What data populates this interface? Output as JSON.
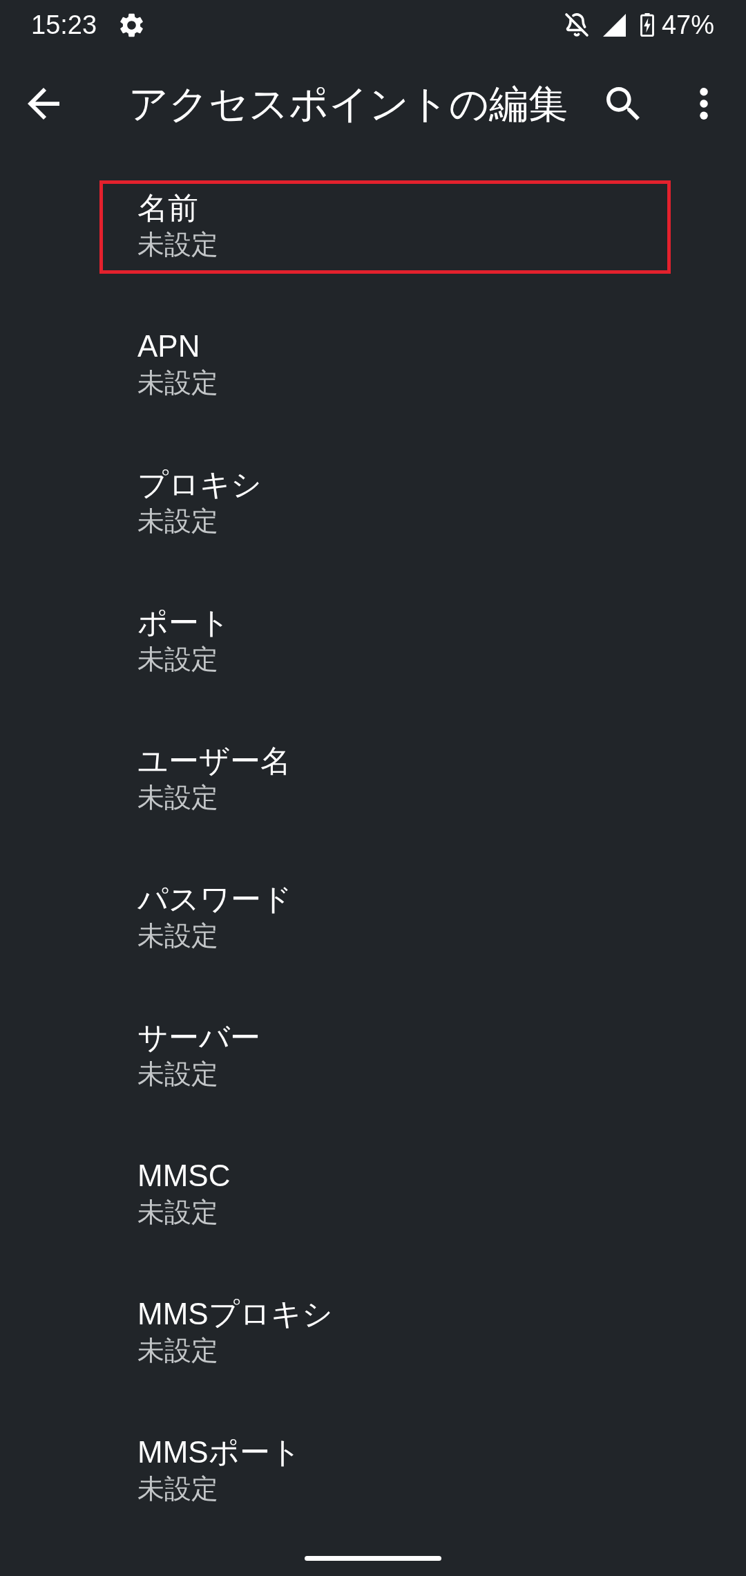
{
  "status_bar": {
    "time": "15:23",
    "battery": "47%"
  },
  "app_bar": {
    "title": "アクセスポイントの編集"
  },
  "items": [
    {
      "title": "名前",
      "summary": "未設定",
      "highlighted": true
    },
    {
      "title": "APN",
      "summary": "未設定",
      "highlighted": false
    },
    {
      "title": "プロキシ",
      "summary": "未設定",
      "highlighted": false
    },
    {
      "title": "ポート",
      "summary": "未設定",
      "highlighted": false
    },
    {
      "title": "ユーザー名",
      "summary": "未設定",
      "highlighted": false
    },
    {
      "title": "パスワード",
      "summary": "未設定",
      "highlighted": false
    },
    {
      "title": "サーバー",
      "summary": "未設定",
      "highlighted": false
    },
    {
      "title": "MMSC",
      "summary": "未設定",
      "highlighted": false
    },
    {
      "title": "MMSプロキシ",
      "summary": "未設定",
      "highlighted": false
    },
    {
      "title": "MMSポート",
      "summary": "未設定",
      "highlighted": false
    }
  ]
}
